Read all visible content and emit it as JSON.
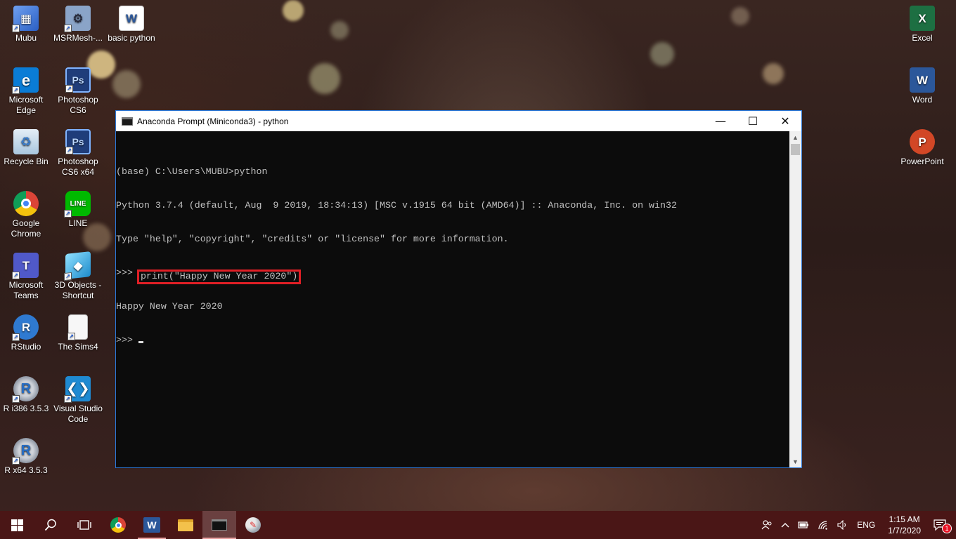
{
  "desktop": {
    "left_icons": [
      {
        "label": "Mubu",
        "icon": "app-icon",
        "color": "#3b6fd6"
      },
      {
        "label": "MSRMesh-...",
        "icon": "tool-icon",
        "color": "#8aa4c8"
      },
      {
        "label": "basic python",
        "icon": "word-doc-icon",
        "color": "#2b579a"
      },
      {
        "label": "Microsoft Edge",
        "icon": "edge-icon",
        "color": "#0a7cd6"
      },
      {
        "label": "Photoshop CS6",
        "icon": "photoshop-icon",
        "color": "#1f3d7a"
      },
      {
        "label": "Recycle Bin",
        "icon": "recycle-bin-icon",
        "color": "#a9c6de"
      },
      {
        "label": "Photoshop CS6 x64",
        "icon": "photoshop-icon",
        "color": "#1f3d7a"
      },
      {
        "label": "Google Chrome",
        "icon": "chrome-icon",
        "color": "#db4437"
      },
      {
        "label": "LINE",
        "icon": "line-icon",
        "color": "#00b900"
      },
      {
        "label": "Microsoft Teams",
        "icon": "teams-icon",
        "color": "#5059c9"
      },
      {
        "label": "3D Objects - Shortcut",
        "icon": "3d-objects-icon",
        "color": "#3fb4e6"
      },
      {
        "label": "RStudio",
        "icon": "rstudio-icon",
        "color": "#2f7ad1"
      },
      {
        "label": "The Sims4",
        "icon": "file-icon",
        "color": "#f2f2f2"
      },
      {
        "label": "R i386 3.5.3",
        "icon": "r-icon",
        "color": "#276dc3"
      },
      {
        "label": "Visual Studio Code",
        "icon": "vscode-icon",
        "color": "#1f8ad2"
      },
      {
        "label": "R x64 3.5.3",
        "icon": "r-icon",
        "color": "#276dc3"
      }
    ],
    "right_icons": [
      {
        "label": "Excel",
        "icon": "excel-icon",
        "color": "#1d6f42"
      },
      {
        "label": "Word",
        "icon": "word-icon",
        "color": "#2b579a"
      },
      {
        "label": "PowerPoint",
        "icon": "powerpoint-icon",
        "color": "#d24726"
      }
    ]
  },
  "window": {
    "title": "Anaconda Prompt (Miniconda3) - python",
    "minimize_glyph": "—",
    "maximize_glyph": "☐",
    "close_glyph": "✕",
    "console": {
      "line1": "(base) C:\\Users\\MUBU>python",
      "line2": "Python 3.7.4 (default, Aug  9 2019, 18:34:13) [MSC v.1915 64 bit (AMD64)] :: Anaconda, Inc. on win32",
      "line3": "Type \"help\", \"copyright\", \"credits\" or \"license\" for more information.",
      "prompt": ">>>",
      "command": "print(\"Happy New Year 2020\")",
      "output": "Happy New Year 2020"
    }
  },
  "taskbar": {
    "items": [
      "start-icon",
      "search-icon",
      "task-view-icon",
      "chrome-icon",
      "word-icon",
      "file-explorer-icon",
      "console-icon",
      "paint-icon"
    ],
    "language": "ENG",
    "time": "1:15 AM",
    "date": "1/7/2020",
    "notification_count": "1"
  },
  "colors": {
    "accent_border": "#2b78d8",
    "highlight": "#e01f26",
    "taskbar": "#4a1616"
  }
}
